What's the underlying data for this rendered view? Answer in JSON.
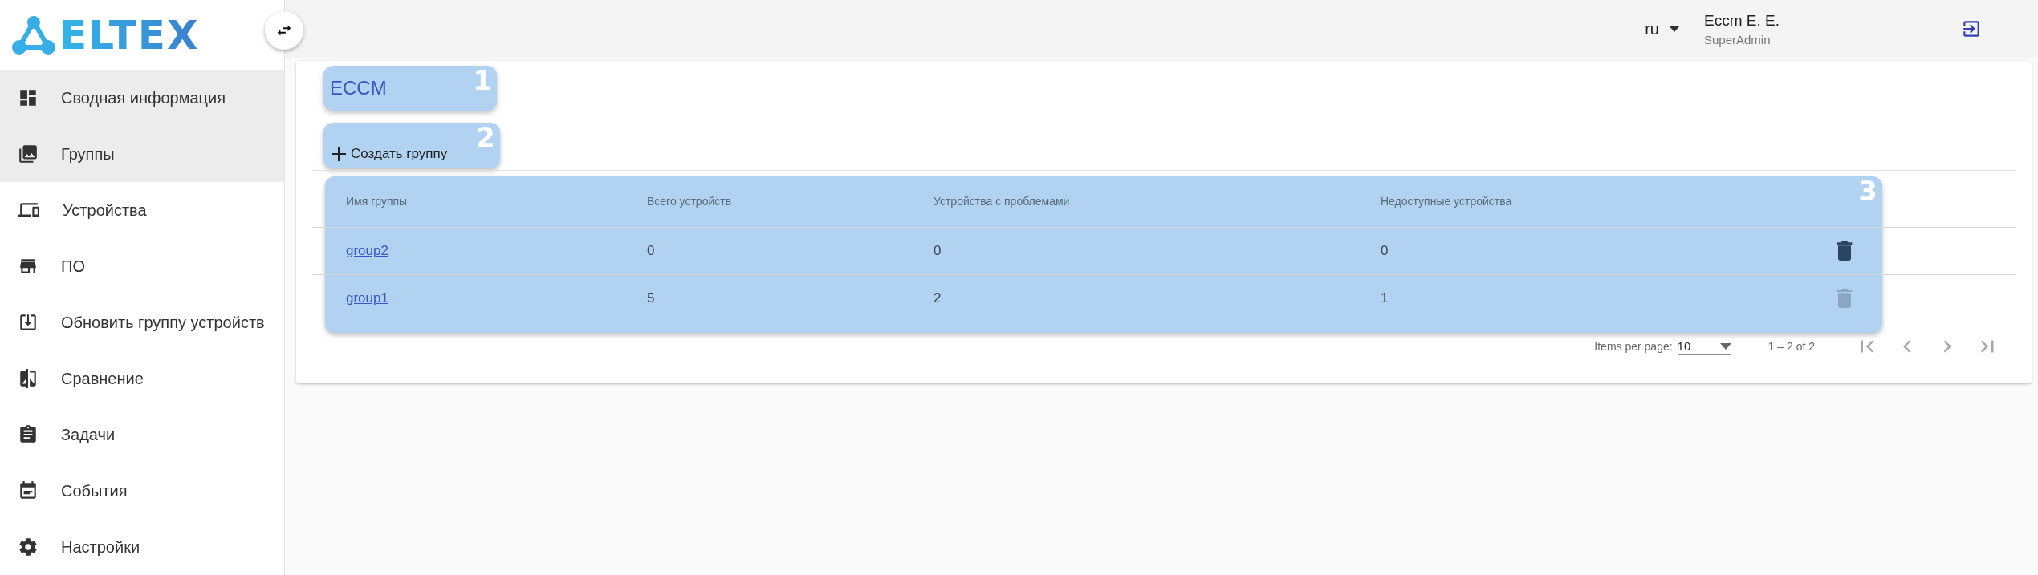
{
  "logo": {
    "text": "ELTEX"
  },
  "sidebar": {
    "items": [
      {
        "label": "Сводная информация",
        "highlighted": true
      },
      {
        "label": "Группы",
        "highlighted": true
      },
      {
        "label": "Устройства",
        "highlighted": false
      },
      {
        "label": "ПО",
        "highlighted": false
      },
      {
        "label": "Обновить группу устройств",
        "highlighted": false
      },
      {
        "label": "Сравнение",
        "highlighted": false
      },
      {
        "label": "Задачи",
        "highlighted": false
      },
      {
        "label": "События",
        "highlighted": false
      },
      {
        "label": "Настройки",
        "highlighted": false
      }
    ]
  },
  "header": {
    "language": "ru",
    "user_name": "Eccm E. E.",
    "user_role": "SuperAdmin"
  },
  "page": {
    "title": "ECCM",
    "title_callout": "1",
    "create_button": "Создать группу",
    "create_callout": "2"
  },
  "table": {
    "callout": "3",
    "columns": [
      "Имя группы",
      "Всего устройств",
      "Устройства с проблемами",
      "Недоступные устройства"
    ],
    "rows": [
      {
        "name": "group2",
        "total": "0",
        "problems": "0",
        "unavailable": "0",
        "delete_disabled": false
      },
      {
        "name": "group1",
        "total": "5",
        "problems": "2",
        "unavailable": "1",
        "delete_disabled": true
      }
    ]
  },
  "pagination": {
    "items_per_page_label": "Items per page:",
    "page_size": "10",
    "range": "1 – 2 of 2",
    "buttons": [
      {
        "kind": "first",
        "disabled": true
      },
      {
        "kind": "prev",
        "disabled": true
      },
      {
        "kind": "next",
        "disabled": true
      },
      {
        "kind": "last",
        "disabled": true
      }
    ]
  }
}
